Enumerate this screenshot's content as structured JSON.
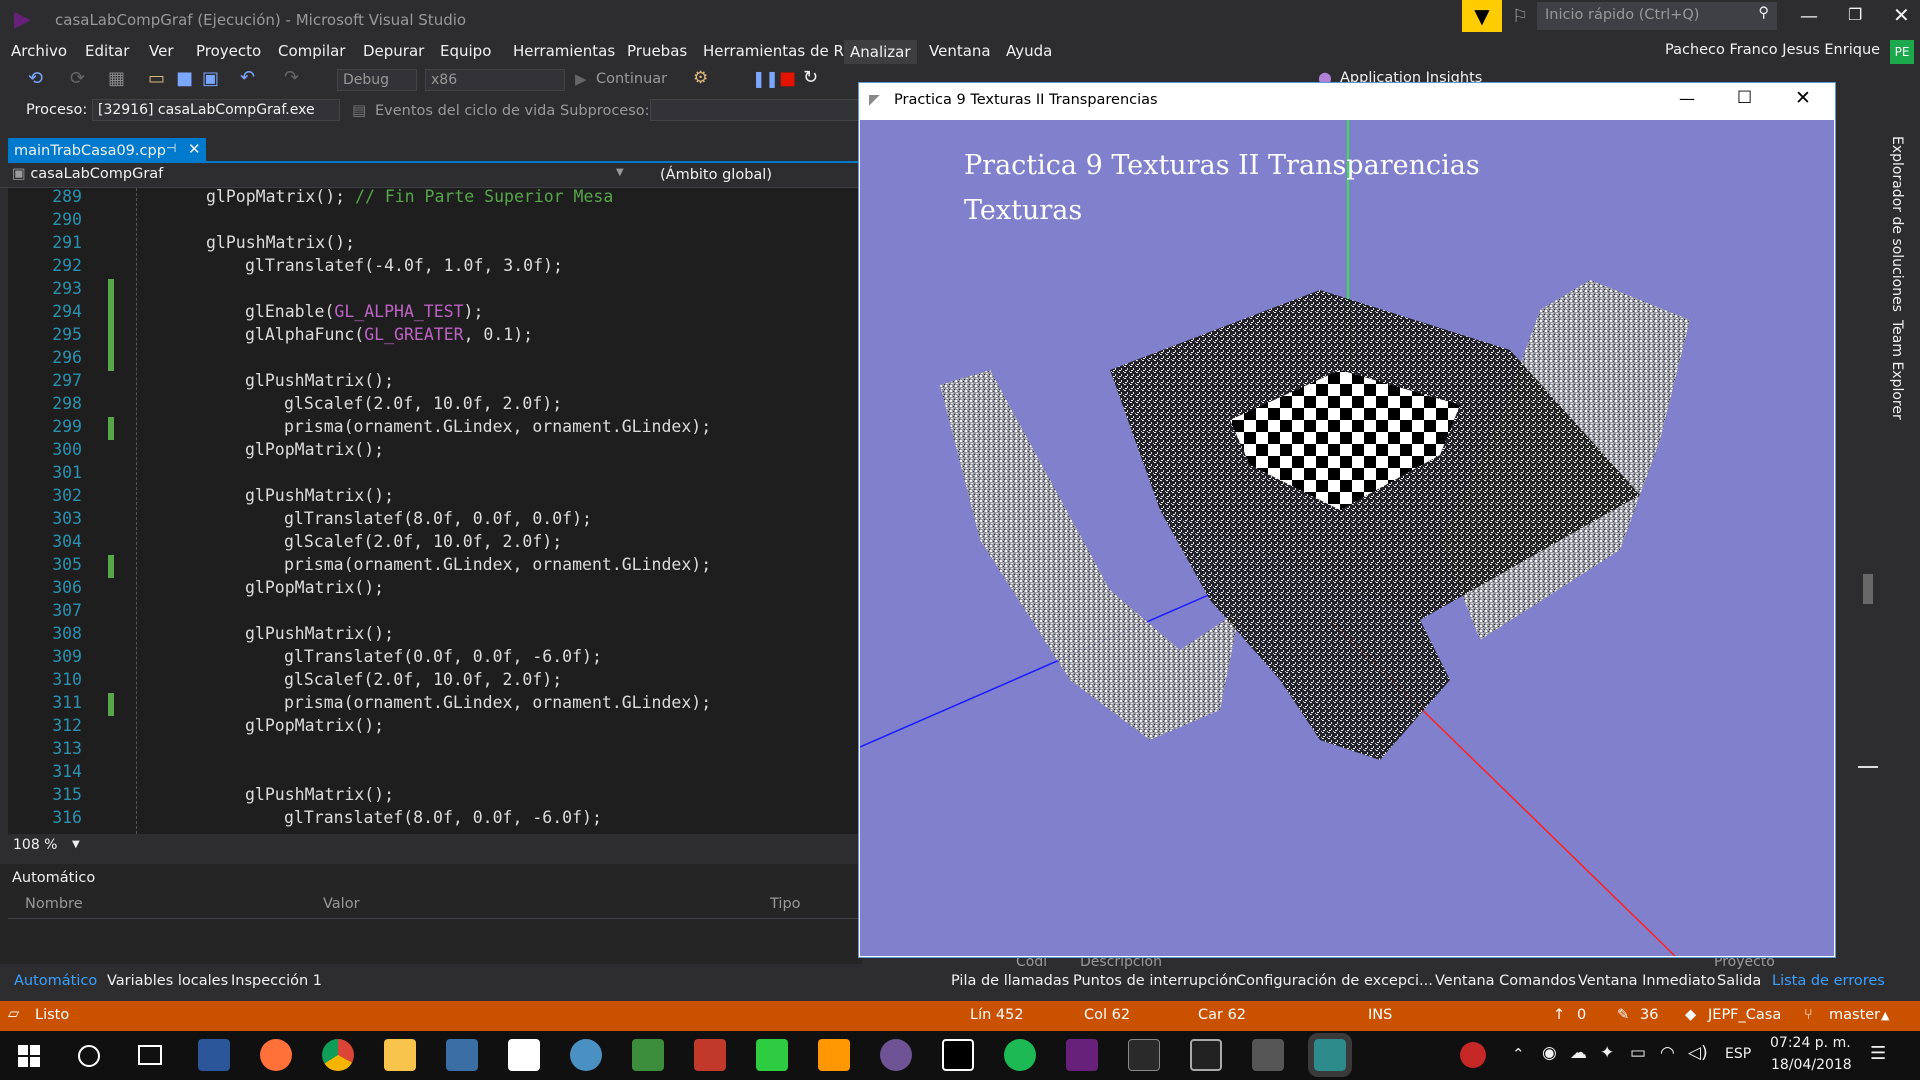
{
  "window": {
    "title": "casaLabCompGraf (Ejecución) - Microsoft Visual Studio",
    "quick_launch": "Inicio rápido (Ctrl+Q)",
    "user": "Pacheco Franco Jesus Enrique",
    "user_initials": "PE"
  },
  "menu": [
    "Archivo",
    "Editar",
    "Ver",
    "Proyecto",
    "Compilar",
    "Depurar",
    "Equipo",
    "Herramientas",
    "Pruebas",
    "Herramientas de R",
    "Analizar",
    "Ventana",
    "Ayuda"
  ],
  "toolbar": {
    "config": "Debug",
    "platform": "x86",
    "continue": "Continuar",
    "app_insights": "Application Insights"
  },
  "process": {
    "label": "Proceso:",
    "value": "[32916] casaLabCompGraf.exe",
    "lifecycle": "Eventos del ciclo de vida",
    "thread_label": "Subproceso:"
  },
  "tabs": [
    {
      "label": "mainTrabCasa09.cpp"
    }
  ],
  "editor": {
    "scope_left": "casaLabCompGraf",
    "scope_right": "(Ámbito global)",
    "zoom": "108 %"
  },
  "code": [
    {
      "n": "289",
      "t": "glPopMatrix(); ",
      "c": "// Fin Parte Superior Mesa",
      "i": 0
    },
    {
      "n": "290",
      "t": "",
      "i": 0
    },
    {
      "n": "291",
      "t": "glPushMatrix();",
      "i": 0
    },
    {
      "n": "292",
      "t": "glTranslatef(-4.0f, 1.0f, 3.0f);",
      "i": 1
    },
    {
      "n": "293",
      "t": "",
      "i": 1
    },
    {
      "n": "294",
      "t": "glEnable(",
      "k": "GL_ALPHA_TEST",
      "e": ");",
      "i": 1
    },
    {
      "n": "295",
      "t": "glAlphaFunc(",
      "k": "GL_GREATER",
      "e": ", 0.1);",
      "i": 1
    },
    {
      "n": "296",
      "t": "",
      "i": 1
    },
    {
      "n": "297",
      "t": "glPushMatrix();",
      "i": 1
    },
    {
      "n": "298",
      "t": "glScalef(2.0f, 10.0f, 2.0f);",
      "i": 2
    },
    {
      "n": "299",
      "t": "prisma(ornament.GLindex, ornament.GLindex);",
      "i": 2
    },
    {
      "n": "300",
      "t": "glPopMatrix();",
      "i": 1
    },
    {
      "n": "301",
      "t": "",
      "i": 1
    },
    {
      "n": "302",
      "t": "glPushMatrix();",
      "i": 1
    },
    {
      "n": "303",
      "t": "glTranslatef(8.0f, 0.0f, 0.0f);",
      "i": 2
    },
    {
      "n": "304",
      "t": "glScalef(2.0f, 10.0f, 2.0f);",
      "i": 2
    },
    {
      "n": "305",
      "t": "prisma(ornament.GLindex, ornament.GLindex);",
      "i": 2
    },
    {
      "n": "306",
      "t": "glPopMatrix();",
      "i": 1
    },
    {
      "n": "307",
      "t": "",
      "i": 1
    },
    {
      "n": "308",
      "t": "glPushMatrix();",
      "i": 1
    },
    {
      "n": "309",
      "t": "glTranslatef(0.0f, 0.0f, -6.0f);",
      "i": 2
    },
    {
      "n": "310",
      "t": "glScalef(2.0f, 10.0f, 2.0f);",
      "i": 2
    },
    {
      "n": "311",
      "t": "prisma(ornament.GLindex, ornament.GLindex);",
      "i": 2
    },
    {
      "n": "312",
      "t": "glPopMatrix();",
      "i": 1
    },
    {
      "n": "313",
      "t": "",
      "i": 1
    },
    {
      "n": "314",
      "t": "",
      "i": 1
    },
    {
      "n": "315",
      "t": "glPushMatrix();",
      "i": 1
    },
    {
      "n": "316",
      "t": "glTranslatef(8.0f, 0.0f, -6.0f);",
      "i": 2
    }
  ],
  "autos": {
    "title": "Automático",
    "col_name": "Nombre",
    "col_value": "Valor",
    "col_type": "Tipo"
  },
  "bottom_tabs_left": [
    "Automático",
    "Variables locales",
    "Inspección 1"
  ],
  "bottom_tabs_right": [
    "Pila de llamadas",
    "Puntos de interrupción",
    "Configuración de excepci...",
    "Ventana Comandos",
    "Ventana Inmediato",
    "Salida",
    "Lista de errores"
  ],
  "hidden_cols": {
    "c1": "Códi",
    "c2": "Descripción",
    "c3": "Proyecto"
  },
  "status": {
    "ready": "Listo",
    "line": "Lín 452",
    "col": "Col 62",
    "car": "Car 62",
    "ins": "INS",
    "up": "0",
    "edits": "36",
    "repo": "JEPF_Casa",
    "branch": "master"
  },
  "right_panels": [
    "Explorador de soluciones",
    "Team Explorer"
  ],
  "gl": {
    "title": "Practica 9 Texturas II Transparencias",
    "line1": "Practica 9 Texturas II Transparencias",
    "line2": "Texturas"
  },
  "taskbar": {
    "lang": "ESP",
    "time": "07:24 p. m.",
    "date": "18/04/2018"
  },
  "colors": {
    "accent": "#ca5100",
    "bg": "#2d2d30",
    "editor": "#1e1e1e",
    "gl_bg": "#8080cc"
  }
}
